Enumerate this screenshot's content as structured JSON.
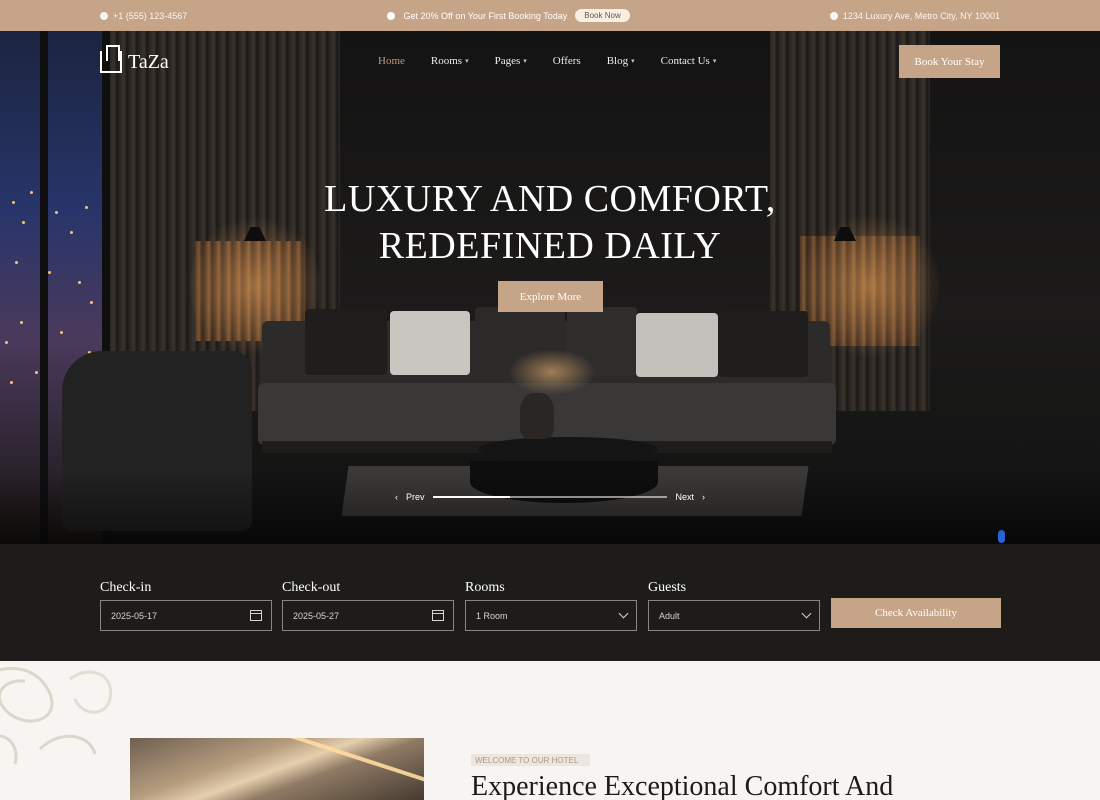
{
  "topbar": {
    "phone": "+1 (555) 123-4567",
    "promo_text": "Get 20% Off on Your First Booking Today",
    "promo_button": "Book Now",
    "address": "1234 Luxury Ave, Metro City, NY 10001"
  },
  "brand": {
    "name": "TaZa"
  },
  "nav": {
    "items": [
      {
        "label": "Home",
        "dropdown": false,
        "active": true
      },
      {
        "label": "Rooms",
        "dropdown": true,
        "active": false
      },
      {
        "label": "Pages",
        "dropdown": true,
        "active": false
      },
      {
        "label": "Offers",
        "dropdown": false,
        "active": false
      },
      {
        "label": "Blog",
        "dropdown": true,
        "active": false
      },
      {
        "label": "Contact Us",
        "dropdown": true,
        "active": false
      }
    ],
    "book_button": "Book Your Stay"
  },
  "hero": {
    "title_line1": "LUXURY AND COMFORT,",
    "title_line2": "REDEFINED DAILY",
    "cta": "Explore More",
    "slider": {
      "prev_label": "Prev",
      "next_label": "Next",
      "progress": 0.33
    }
  },
  "booking": {
    "check_in": {
      "label": "Check-in",
      "value": "2025-05-17"
    },
    "check_out": {
      "label": "Check-out",
      "value": "2025-05-27"
    },
    "rooms": {
      "label": "Rooms",
      "value": "1 Room"
    },
    "guests": {
      "label": "Guests",
      "value": "Adult"
    },
    "submit": "Check Availability"
  },
  "about": {
    "tag": "WELCOME TO OUR HOTEL",
    "title": "Experience Exceptional Comfort And"
  },
  "colors": {
    "accent": "#c6a487",
    "hero_dark": "#1d1c1b",
    "page_bg": "#f6f5f2"
  }
}
